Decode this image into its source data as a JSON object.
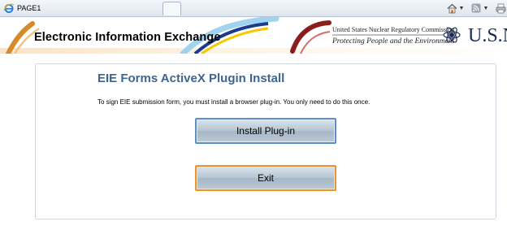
{
  "browser": {
    "tab_title": "PAGE1",
    "icons": [
      "internet-explorer-icon",
      "home-icon",
      "rss-feed-icon",
      "print-icon"
    ]
  },
  "banner": {
    "title": "Electronic Information Exchange",
    "agency_name": "United States Nuclear Regulatory Commission",
    "tagline": "Protecting People and the Environment",
    "agency_abbrev": "U.S.N"
  },
  "page": {
    "heading": "EIE Forms ActiveX Plugin Install",
    "message": "To sign EIE submission form, you must install a browser plug-in.  You only need to do this once.",
    "install_button": "Install Plug-in",
    "exit_button": "Exit"
  },
  "colors": {
    "heading": "#3e6590",
    "install_border": "#5b8fc7",
    "exit_border": "#e8952e",
    "button_face": "#b6c6d3"
  }
}
